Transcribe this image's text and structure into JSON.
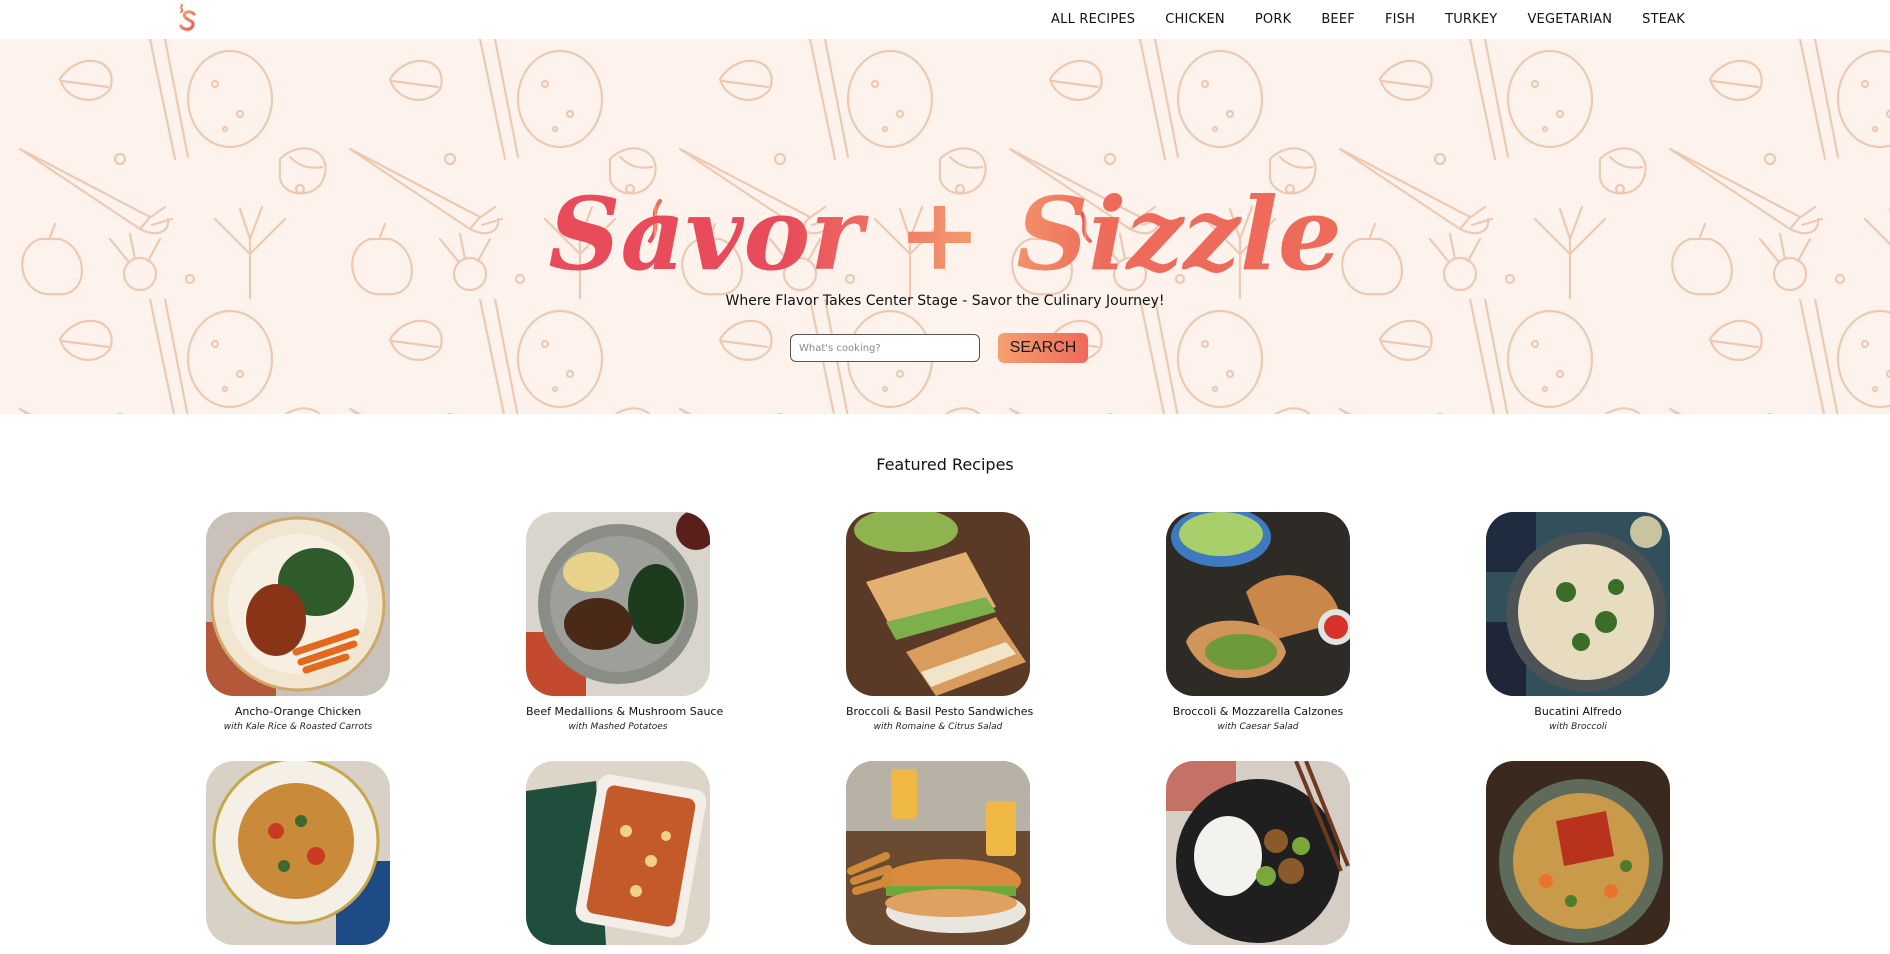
{
  "site": {
    "brand_name": "Savor + Sizzle",
    "tagline": "Where Flavor Takes Center Stage - Savor the Culinary Journey!",
    "accent_from": "#f4a070",
    "accent_to": "#ee6a5a"
  },
  "nav": {
    "items": [
      "ALL RECIPES",
      "CHICKEN",
      "PORK",
      "BEEF",
      "FISH",
      "TURKEY",
      "VEGETARIAN",
      "STEAK"
    ]
  },
  "search": {
    "placeholder": "What's cooking?",
    "button_label": "SEARCH"
  },
  "featured": {
    "heading": "Featured Recipes",
    "recipes": [
      {
        "title": "Ancho-Orange Chicken",
        "subtitle": "with Kale Rice & Roasted Carrots",
        "image": "plate-chicken-kale-rice"
      },
      {
        "title": "Beef Medallions & Mushroom Sauce",
        "subtitle": "with Mashed Potatoes",
        "image": "plate-beef-mushroom"
      },
      {
        "title": "Broccoli & Basil Pesto Sandwiches",
        "subtitle": "with Romaine & Citrus Salad",
        "image": "sandwich-halves"
      },
      {
        "title": "Broccoli & Mozzarella Calzones",
        "subtitle": "with Caesar Salad",
        "image": "calzones-board"
      },
      {
        "title": "Bucatini Alfredo",
        "subtitle": "with Broccoli",
        "image": "pasta-alfredo-bowl"
      },
      {
        "title": "",
        "subtitle": "",
        "image": "spaghetti-bowl"
      },
      {
        "title": "",
        "subtitle": "",
        "image": "lasagna-dish"
      },
      {
        "title": "",
        "subtitle": "",
        "image": "sub-sandwich-fries"
      },
      {
        "title": "",
        "subtitle": "",
        "image": "stir-fry-rice"
      },
      {
        "title": "",
        "subtitle": "",
        "image": "salmon-noodles"
      }
    ]
  }
}
